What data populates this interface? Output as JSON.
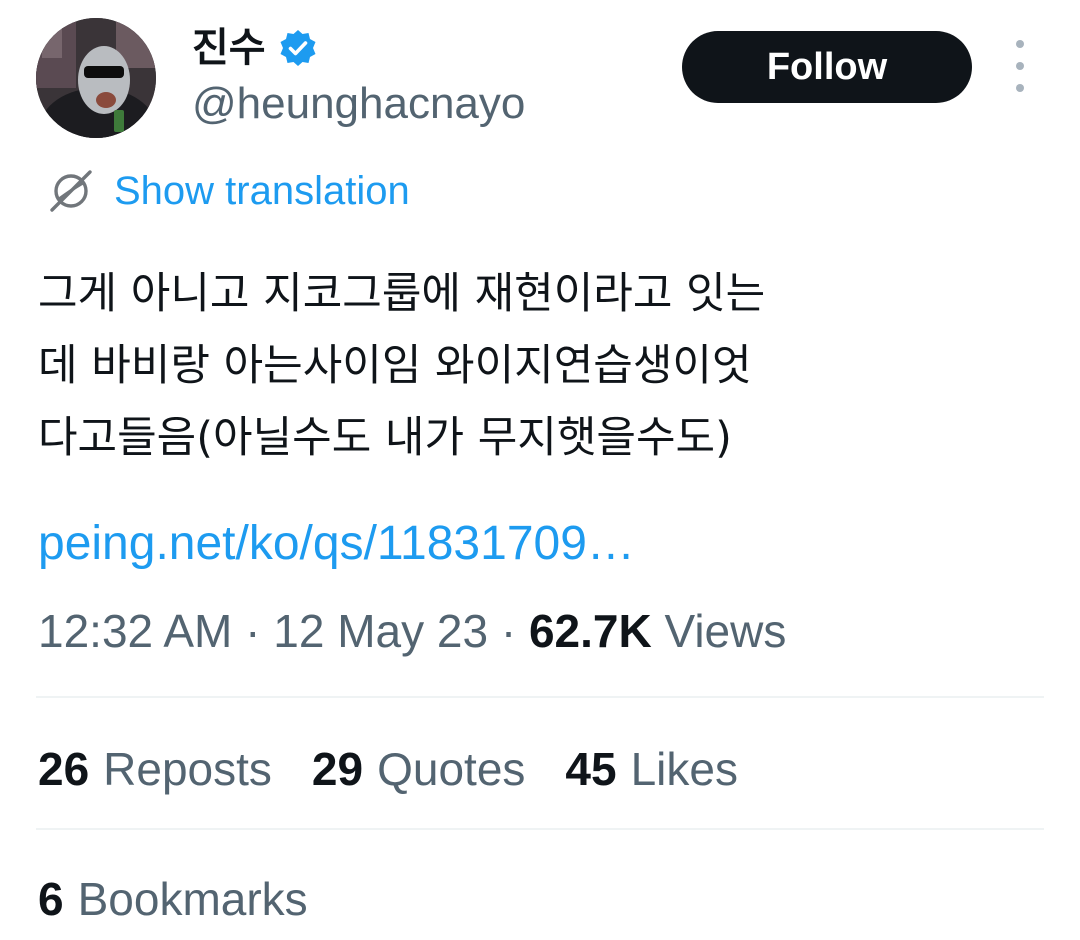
{
  "author": {
    "display_name": "진수",
    "handle": "@heunghacnayo",
    "verified_icon": "verified-badge-icon",
    "avatar_icon": "avatar-image"
  },
  "actions": {
    "follow_label": "Follow",
    "more_icon": "more-vertical-icon"
  },
  "translation": {
    "label": "Show translation",
    "icon": "translate-globe-icon"
  },
  "tweet": {
    "text": "그게 아니고 지코그룹에 재현이라고 잇는\n데 바비랑 아는사이임 와이지연습생이엇\n다고들음(아닐수도 내가 무지햇을수도)",
    "link": "peing.net/ko/qs/11831709…"
  },
  "meta": {
    "time": "12:32 AM",
    "separator": " · ",
    "date": "12 May 23",
    "views_count": "62.7K",
    "views_label": "Views"
  },
  "stats": {
    "reposts_count": "26",
    "reposts_label": "Reposts",
    "quotes_count": "29",
    "quotes_label": "Quotes",
    "likes_count": "45",
    "likes_label": "Likes",
    "bookmarks_count": "6",
    "bookmarks_label": "Bookmarks"
  },
  "colors": {
    "accent": "#1d9bf0",
    "text_primary": "#0f1419",
    "text_secondary": "#536471",
    "divider": "#eff3f4",
    "button_bg": "#0f1419"
  }
}
